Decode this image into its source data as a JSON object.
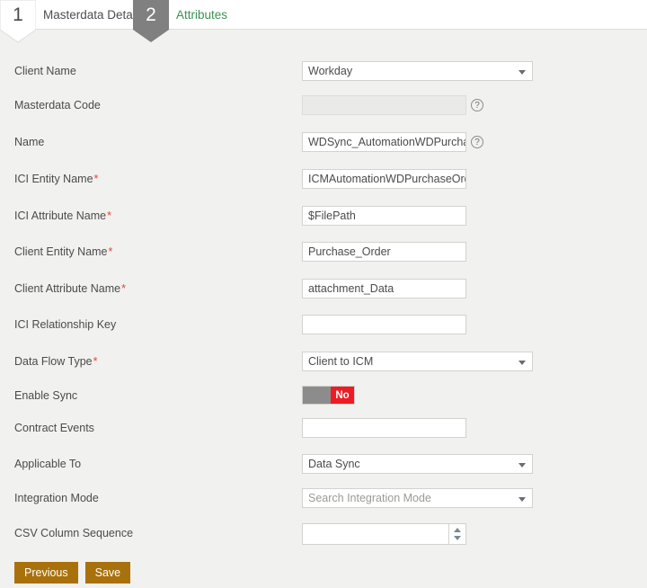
{
  "wizard": {
    "steps": [
      {
        "number": "1",
        "label": "Masterdata Details",
        "active": false
      },
      {
        "number": "2",
        "label": "Attributes",
        "active": true
      }
    ]
  },
  "form": {
    "fields": [
      {
        "label": "Client Name",
        "required": false,
        "control": "select",
        "value": "Workday"
      },
      {
        "label": "Masterdata Code",
        "required": false,
        "control": "text",
        "value": "",
        "disabled": true,
        "help": true
      },
      {
        "label": "Name",
        "required": false,
        "control": "text",
        "value": "WDSync_AutomationWDPurchaseOr",
        "help": true
      },
      {
        "label": "ICI Entity Name",
        "required": true,
        "control": "text",
        "value": "ICMAutomationWDPurchaseOrder"
      },
      {
        "label": "ICI Attribute Name",
        "required": true,
        "control": "text",
        "value": "$FilePath"
      },
      {
        "label": "Client Entity Name",
        "required": true,
        "control": "text",
        "value": "Purchase_Order"
      },
      {
        "label": "Client Attribute Name",
        "required": true,
        "control": "text",
        "value": "attachment_Data"
      },
      {
        "label": "ICI Relationship Key",
        "required": false,
        "control": "text",
        "value": ""
      },
      {
        "label": "Data Flow Type",
        "required": true,
        "control": "select",
        "value": "Client to ICM"
      },
      {
        "label": "Enable Sync",
        "required": false,
        "control": "toggle",
        "value": "No"
      },
      {
        "label": "Contract Events",
        "required": false,
        "control": "text",
        "value": ""
      },
      {
        "label": "Applicable To",
        "required": false,
        "control": "select",
        "value": "Data Sync"
      },
      {
        "label": "Integration Mode",
        "required": false,
        "control": "select",
        "value": "Search Integration Mode",
        "placeholder": true
      },
      {
        "label": "CSV Column Sequence",
        "required": false,
        "control": "spinner",
        "value": ""
      }
    ]
  },
  "buttons": {
    "previous_label": "Previous",
    "save_label": "Save"
  },
  "icons": {
    "help": "?"
  },
  "colors": {
    "active_step": "#3f8f52",
    "required_marker": "#e8453c",
    "button": "#a9710c",
    "toggle_off": "#ed1c24",
    "page_background": "#f1f1ef"
  }
}
